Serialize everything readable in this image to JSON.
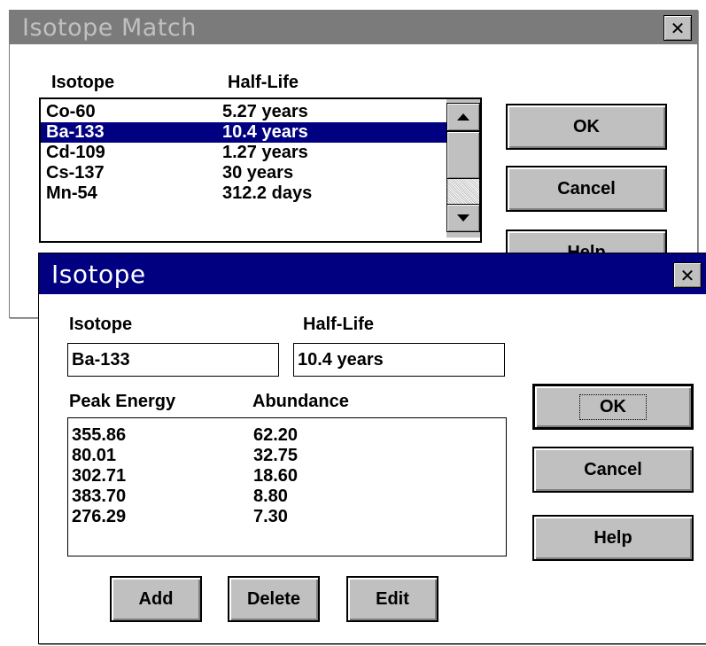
{
  "back_dialog": {
    "title": "Isotope Match",
    "close_glyph": "✕",
    "col_isotope": "Isotope",
    "col_half_life": "Half-Life",
    "rows": [
      {
        "isotope": "Co-60",
        "half_life": "5.27 years",
        "selected": false
      },
      {
        "isotope": "Ba-133",
        "half_life": "10.4 years",
        "selected": true
      },
      {
        "isotope": "Cd-109",
        "half_life": "1.27 years",
        "selected": false
      },
      {
        "isotope": "Cs-137",
        "half_life": "30 years",
        "selected": false
      },
      {
        "isotope": "Mn-54",
        "half_life": "312.2 days",
        "selected": false
      }
    ],
    "ok_label": "OK",
    "cancel_label": "Cancel",
    "help_label": "Help"
  },
  "front_dialog": {
    "title": "Isotope",
    "close_glyph": "✕",
    "isotope_label": "Isotope",
    "isotope_value": "Ba-133",
    "half_life_label": "Half-Life",
    "half_life_value": "10.4 years",
    "col_peak_energy": "Peak Energy",
    "col_abundance": "Abundance",
    "peaks": [
      {
        "energy": "355.86",
        "abundance": "62.20"
      },
      {
        "energy": "80.01",
        "abundance": "32.75"
      },
      {
        "energy": "302.71",
        "abundance": "18.60"
      },
      {
        "energy": "383.70",
        "abundance": "8.80"
      },
      {
        "energy": "276.29",
        "abundance": "7.30"
      }
    ],
    "ok_label": "OK",
    "cancel_label": "Cancel",
    "help_label": "Help",
    "add_label": "Add",
    "delete_label": "Delete",
    "edit_label": "Edit"
  },
  "colors": {
    "inactive_title_bg": "#7b7b7b",
    "inactive_title_text": "#c0c0c0",
    "active_title_bg": "#000080",
    "active_title_text": "#ffffff",
    "selection_bg": "#000080",
    "button_face": "#c0c0c0"
  },
  "icons": {
    "close": "close-icon",
    "scroll_up": "arrow-up-icon",
    "scroll_down": "arrow-down-icon"
  }
}
